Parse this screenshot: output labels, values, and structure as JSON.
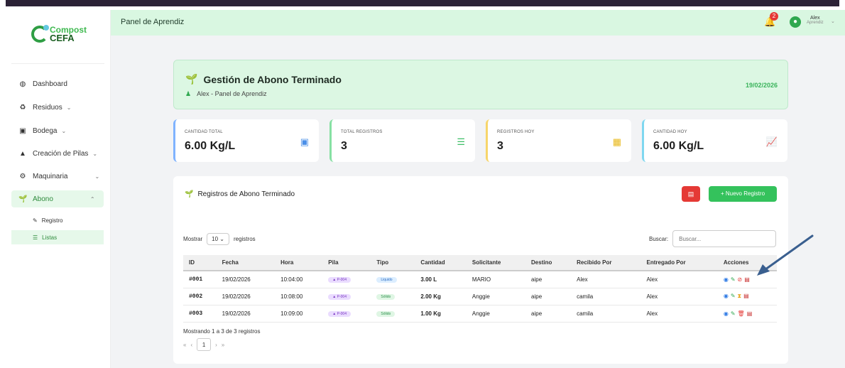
{
  "brand": {
    "line1": "Compost",
    "line2": "CEFA"
  },
  "sidebar": {
    "items": [
      {
        "label": "Dashboard",
        "icon": "dashboard-icon",
        "glyph": "◍"
      },
      {
        "label": "Residuos",
        "icon": "recycle-icon",
        "glyph": "♻",
        "chev": "⌄"
      },
      {
        "label": "Bodega",
        "icon": "warehouse-icon",
        "glyph": "▣",
        "chev": "⌄"
      },
      {
        "label": "Creación de Pilas",
        "icon": "mountain-icon",
        "glyph": "▲",
        "chev": "⌄"
      },
      {
        "label": "Maquinaria",
        "icon": "gears-icon",
        "glyph": "⚙",
        "chev": "⌄"
      },
      {
        "label": "Abono",
        "icon": "seedling-icon",
        "glyph": "🌱",
        "chev": "⌃"
      }
    ],
    "sub": [
      {
        "label": "Registro",
        "glyph": "✎"
      },
      {
        "label": "Listas",
        "glyph": "☰"
      }
    ]
  },
  "header": {
    "title": "Panel de Aprendiz",
    "notif_count": "2",
    "user_name": "Alex",
    "user_role": "Aprendiz"
  },
  "banner": {
    "title": "Gestión de Abono Terminado",
    "subtitle": "Alex - Panel de Aprendiz",
    "date": "19/02/2026"
  },
  "cards": [
    {
      "label": "CANTIDAD TOTAL",
      "value": "6.00 Kg/L",
      "color": "#7fb3ff"
    },
    {
      "label": "TOTAL REGISTROS",
      "value": "3",
      "color": "#86e0a3"
    },
    {
      "label": "REGISTROS HOY",
      "value": "3",
      "color": "#f7d56a"
    },
    {
      "label": "CANTIDAD HOY",
      "value": "6.00 Kg/L",
      "color": "#7fd7f0"
    }
  ],
  "table": {
    "title": "Registros de Abono Terminado",
    "new_button": "+ Nuevo Registro",
    "show_label": "Mostrar",
    "show_value": "10",
    "records_label": "registros",
    "search_label": "Buscar:",
    "search_placeholder": "Buscar...",
    "columns": [
      "ID",
      "Fecha",
      "Hora",
      "Pila",
      "Tipo",
      "Cantidad",
      "Solicitante",
      "Destino",
      "Recibido Por",
      "Entregado Por",
      "Acciones"
    ],
    "rows": [
      {
        "id": "#001",
        "fecha": "19/02/2026",
        "hora": "10:04:00",
        "pila": "▲ P-004",
        "tipo": "Liquido",
        "cantidad": "3.00 L",
        "solicitante": "MARIO",
        "destino": "aipe",
        "recibido": "Alex",
        "entregado": "Alex"
      },
      {
        "id": "#002",
        "fecha": "19/02/2026",
        "hora": "10:08:00",
        "pila": "▲ P-004",
        "tipo": "Sólido",
        "cantidad": "2.00 Kg",
        "solicitante": "Anggie",
        "destino": "aipe",
        "recibido": "camila",
        "entregado": "Alex"
      },
      {
        "id": "#003",
        "fecha": "19/02/2026",
        "hora": "10:09:00",
        "pila": "▲ P-004",
        "tipo": "Sólido",
        "cantidad": "1.00 Kg",
        "solicitante": "Anggie",
        "destino": "aipe",
        "recibido": "camila",
        "entregado": "Alex"
      }
    ],
    "info": "Mostrando 1 a 3 de 3 registros",
    "pager": {
      "first": "«",
      "prev": "‹",
      "page": "1",
      "next": "›",
      "last": "»"
    }
  }
}
